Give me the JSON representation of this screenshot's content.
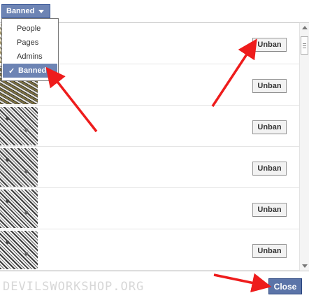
{
  "filter": {
    "button_label": "Banned"
  },
  "menu": {
    "items": [
      {
        "label": "People",
        "selected": false
      },
      {
        "label": "Pages",
        "selected": false
      },
      {
        "label": "Admins",
        "selected": false
      },
      {
        "label": "Banned",
        "selected": true,
        "check": "✓"
      }
    ]
  },
  "rows": [
    {
      "action_label": "Unban"
    },
    {
      "action_label": "Unban"
    },
    {
      "action_label": "Unban"
    },
    {
      "action_label": "Unban"
    },
    {
      "action_label": "Unban"
    },
    {
      "action_label": "Unban"
    }
  ],
  "footer": {
    "watermark": "DEVILSWORKSHOP.ORG",
    "close_label": "Close"
  },
  "colors": {
    "accent": "#6d84b4",
    "close_button": "#5b74a8",
    "annotation_arrow": "#ee1c1c"
  },
  "icons": [
    "chevron-down-icon",
    "check-icon",
    "scroll-up-icon",
    "scroll-down-icon"
  ]
}
